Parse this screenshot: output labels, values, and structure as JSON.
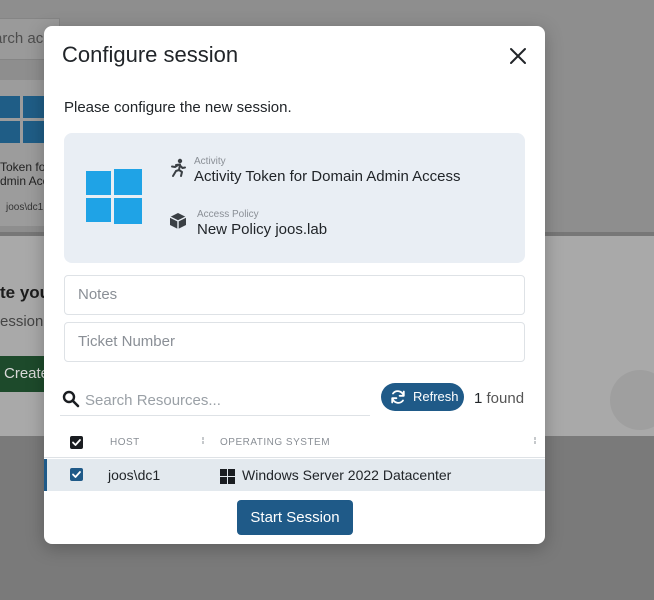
{
  "background": {
    "search_text": "arch ac",
    "card": {
      "line1": "Token for",
      "line2": "dmin Acce",
      "host": "joos\\dc1"
    },
    "heading": "te you",
    "subtext": "ession",
    "create_label": "Create"
  },
  "modal": {
    "title": "Configure session",
    "intro": "Please configure the new session.",
    "activity": {
      "label": "Activity",
      "value": "Activity Token for Domain Admin Access",
      "icon": "running-person-icon"
    },
    "access_policy": {
      "label": "Access Policy",
      "value": "New Policy joos.lab",
      "icon": "box-icon"
    },
    "os_logo": "windows-logo",
    "notes_placeholder": "Notes",
    "ticket_placeholder": "Ticket Number",
    "search_placeholder": "Search Resources...",
    "refresh_label": "Refresh",
    "found_count": "1",
    "found_label": "found",
    "table": {
      "headers": {
        "host": "HOST",
        "os": "OPERATING SYSTEM"
      },
      "rows": [
        {
          "host": "joos\\dc1",
          "os": "Windows Server 2022 Datacenter",
          "checked": true
        }
      ]
    },
    "start_label": "Start Session"
  },
  "colors": {
    "primary": "#1f5a88",
    "windows_blue": "#1fa3e6",
    "info_bg": "#e9eef4",
    "selected_row_bg": "#e3e9ee"
  }
}
